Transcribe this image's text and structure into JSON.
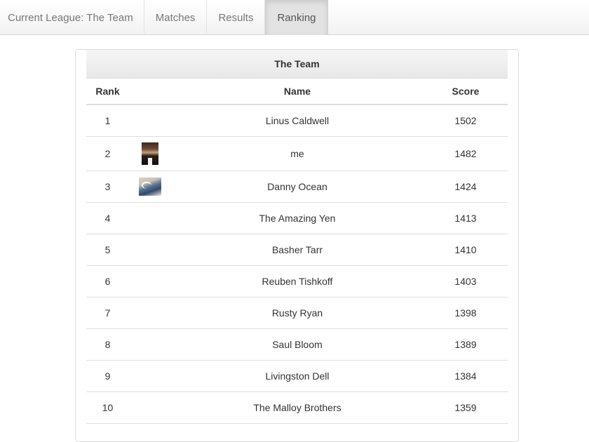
{
  "nav": {
    "brand": "Current League: The Team",
    "tabs": [
      {
        "label": "Matches",
        "active": false
      },
      {
        "label": "Results",
        "active": false
      },
      {
        "label": "Ranking",
        "active": true
      }
    ]
  },
  "table": {
    "caption": "The Team",
    "headers": {
      "rank": "Rank",
      "name": "Name",
      "score": "Score"
    },
    "rows": [
      {
        "rank": "1",
        "name": "Linus Caldwell",
        "score": "1502",
        "avatar": ""
      },
      {
        "rank": "2",
        "name": "me",
        "score": "1482",
        "avatar": "person-photo"
      },
      {
        "rank": "3",
        "name": "Danny Ocean",
        "score": "1424",
        "avatar": "wave-painting"
      },
      {
        "rank": "4",
        "name": "The Amazing Yen",
        "score": "1413",
        "avatar": ""
      },
      {
        "rank": "5",
        "name": "Basher Tarr",
        "score": "1410",
        "avatar": ""
      },
      {
        "rank": "6",
        "name": "Reuben Tishkoff",
        "score": "1403",
        "avatar": ""
      },
      {
        "rank": "7",
        "name": "Rusty Ryan",
        "score": "1398",
        "avatar": ""
      },
      {
        "rank": "8",
        "name": "Saul Bloom",
        "score": "1389",
        "avatar": ""
      },
      {
        "rank": "9",
        "name": "Livingston Dell",
        "score": "1384",
        "avatar": ""
      },
      {
        "rank": "10",
        "name": "The Malloy Brothers",
        "score": "1359",
        "avatar": ""
      }
    ]
  }
}
